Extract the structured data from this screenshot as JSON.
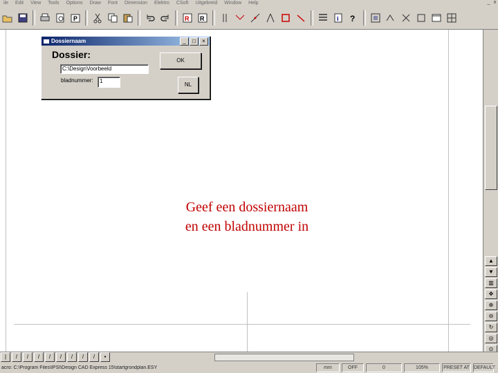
{
  "menubar": {
    "items": [
      "ile",
      "Edit",
      "View",
      "Tools",
      "Options",
      "Draw",
      "Font",
      "Dimension",
      "Elektro",
      "CSoft",
      "Uitgebreid",
      "Window",
      "Help"
    ],
    "window_controls": [
      "_",
      "x"
    ]
  },
  "toolbar": {
    "icons": [
      "open-icon",
      "save-icon",
      "print-icon",
      "print-preview-icon",
      "print-setup-icon",
      "cut-icon",
      "copy-icon",
      "paste-icon",
      "undo-icon",
      "redo-icon",
      "zoom-region-icon",
      "reference-icon",
      "parallel-icon",
      "line-icon",
      "point-icon",
      "angle-icon",
      "rectangle-icon",
      "arc-icon",
      "table-icon",
      "info-icon",
      "help-icon",
      "zoom-fit-icon",
      "trim-icon",
      "delete-icon",
      "frame-icon",
      "window-icon",
      "grid-icon"
    ]
  },
  "dialog": {
    "title": "Dossiernaam",
    "heading": "Dossier:",
    "dossier_value": "C:\\DesignVoorbeeld",
    "sheet_label": "bladnummer:",
    "sheet_value": "1",
    "ok_label": "OK",
    "lang_label": "NL"
  },
  "caption": {
    "line1": "Geef een dossiernaam",
    "line2": "en een bladnummer in"
  },
  "statusbar": {
    "path": "acro: C:\\Program Files\\IPSI\\Design CAD Express 15\\startgrondplan.ESY",
    "units": "mm",
    "snap": "OFF",
    "layer": "0",
    "zoom": "105%",
    "preset": "PRESET AT",
    "mode": "DEFAULT"
  },
  "colors": {
    "caption": "#c00000",
    "titlebar": "#0a246a",
    "chrome": "#d4d0c8"
  }
}
